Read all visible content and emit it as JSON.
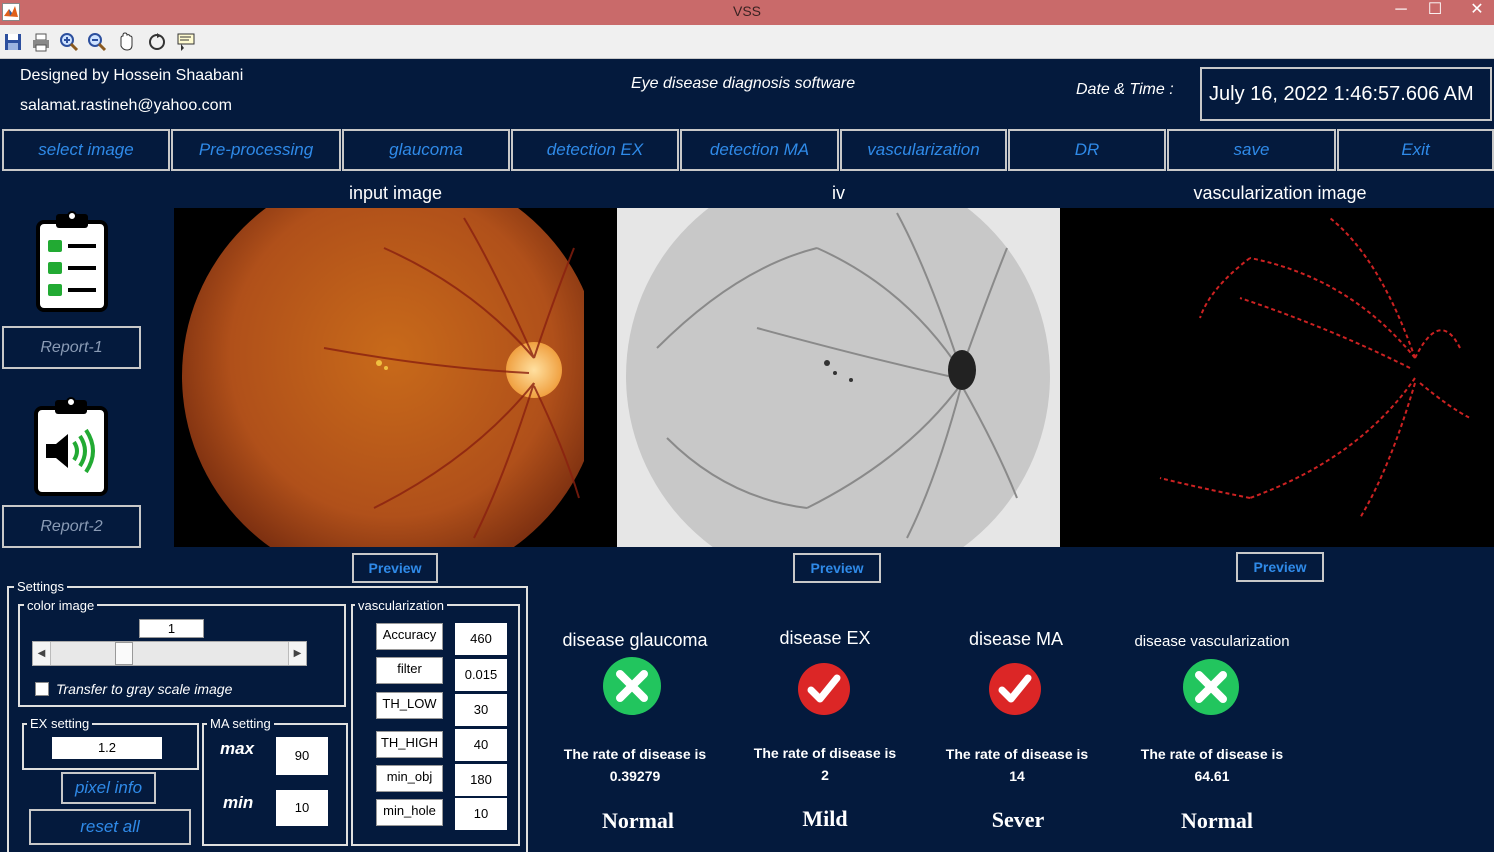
{
  "window": {
    "title": "VSS",
    "minimize": "─",
    "maximize": "☐",
    "close": "✕"
  },
  "toolbar": {
    "icons": [
      "save-icon",
      "print-icon",
      "zoom-in-icon",
      "zoom-out-icon",
      "pan-icon",
      "rotate-icon",
      "data-cursor-icon"
    ]
  },
  "header": {
    "designer": "Designed by Hossein Shaabani",
    "email": "salamat.rastineh@yahoo.com",
    "app_name": "Eye disease diagnosis software",
    "datetime_label": "Date & Time :",
    "datetime_value": "July 16, 2022  1:46:57.606 AM"
  },
  "nav": {
    "select_image": "select image",
    "pre_processing": "Pre-processing",
    "glaucoma": "glaucoma",
    "detection_ex": "detection EX",
    "detection_ma": "detection MA",
    "vascularization": "vascularization",
    "dr": "DR",
    "save": "save",
    "exit": "Exit"
  },
  "panels": {
    "input_title": "input image",
    "iv_title": "iv",
    "vasc_title": "vascularization image",
    "preview": "Preview"
  },
  "reports": {
    "report1": "Report-1",
    "report2": "Report-2"
  },
  "settings": {
    "label": "Settings",
    "color_image": {
      "label": "color image",
      "slider_value": "1",
      "checkbox_label": "Transfer to gray scale image"
    },
    "ex_setting": {
      "label": "EX setting",
      "value": "1.2"
    },
    "ma_setting": {
      "label": "MA setting",
      "max_label": "max",
      "max_value": "90",
      "min_label": "min",
      "min_value": "10"
    },
    "pixel_info": "pixel info",
    "reset_all": "reset all",
    "vascularization": {
      "label": "vascularization",
      "params": [
        {
          "name": "Accuracy",
          "value": "460"
        },
        {
          "name": "filter",
          "value": "0.015"
        },
        {
          "name": "TH_LOW",
          "value": "30"
        },
        {
          "name": "TH_HIGH",
          "value": "40"
        },
        {
          "name": "min_obj",
          "value": "180"
        },
        {
          "name": "min_hole",
          "value": "10"
        }
      ]
    }
  },
  "results": [
    {
      "title": "disease glaucoma",
      "icon": "green-x-icon",
      "rate_label": "The rate of disease is",
      "rate": "0.39279",
      "status": "Normal"
    },
    {
      "title": "disease EX",
      "icon": "red-check-icon",
      "rate_label": "The rate of disease is",
      "rate": "2",
      "status": "Mild"
    },
    {
      "title": "disease MA",
      "icon": "red-check-icon",
      "rate_label": "The rate of disease is",
      "rate": "14",
      "status": "Sever"
    },
    {
      "title": "disease vascularization",
      "icon": "green-x-icon",
      "rate_label": "The rate of disease is",
      "rate": "64.61",
      "status": "Normal"
    }
  ],
  "colors": {
    "background": "#041a3d",
    "accent_blue": "#2f8ae8",
    "titlebar": "#c96a6a",
    "green": "#22c55e",
    "red": "#dc2626"
  }
}
